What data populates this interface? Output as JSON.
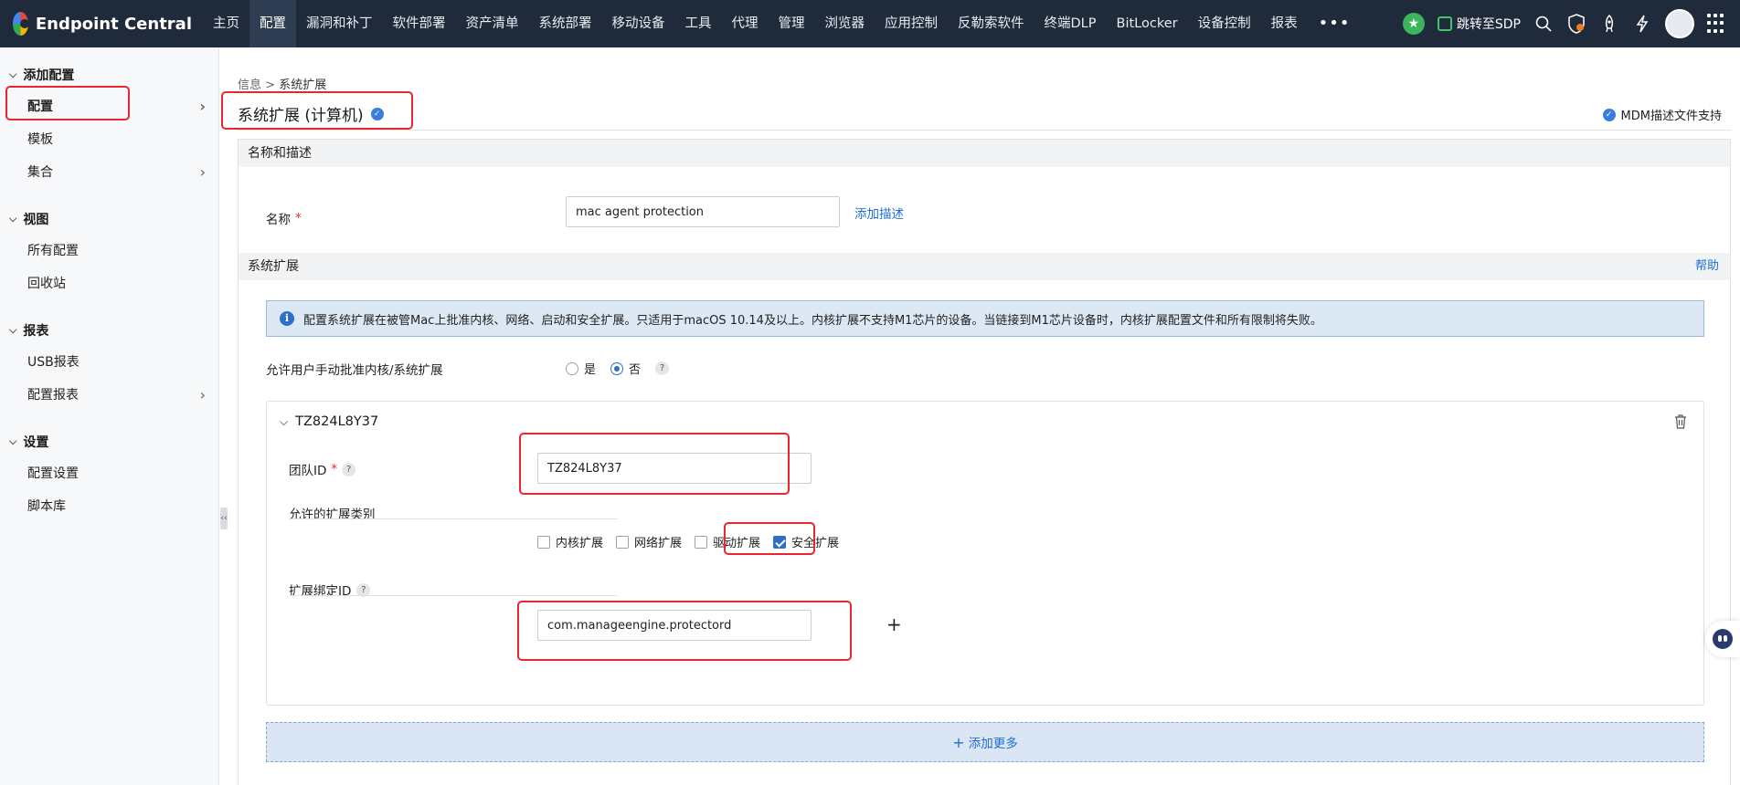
{
  "app": {
    "name": "Endpoint Central"
  },
  "nav": {
    "items": [
      "主页",
      "配置",
      "漏洞和补丁",
      "软件部署",
      "资产清单",
      "系统部署",
      "移动设备",
      "工具",
      "代理",
      "管理",
      "浏览器",
      "应用控制",
      "反勒索软件",
      "终端DLP",
      "BitLocker",
      "设备控制",
      "报表"
    ],
    "active": "配置",
    "more": "•••",
    "sdp_label": "跳转至SDP"
  },
  "sidebar": {
    "sections": [
      {
        "title": "添加配置",
        "items": [
          {
            "label": "配置",
            "has_children": true,
            "active": true
          },
          {
            "label": "模板",
            "has_children": false
          },
          {
            "label": "集合",
            "has_children": true
          }
        ]
      },
      {
        "title": "视图",
        "items": [
          {
            "label": "所有配置",
            "has_children": false
          },
          {
            "label": "回收站",
            "has_children": false
          }
        ]
      },
      {
        "title": "报表",
        "items": [
          {
            "label": "USB报表",
            "has_children": false
          },
          {
            "label": "配置报表",
            "has_children": true
          }
        ]
      },
      {
        "title": "设置",
        "items": [
          {
            "label": "配置设置",
            "has_children": false
          },
          {
            "label": "脚本库",
            "has_children": false
          }
        ]
      }
    ]
  },
  "breadcrumb": {
    "parent": "信息",
    "separator": ">",
    "current": "系统扩展"
  },
  "page": {
    "title": "系统扩展 (计算机)",
    "mdm_label": "MDM描述文件支持"
  },
  "name_section": {
    "header": "名称和描述",
    "name_label": "名称",
    "name_value": "mac agent protection",
    "add_description": "添加描述"
  },
  "ext_section": {
    "header": "系统扩展",
    "help": "帮助",
    "info": "配置系统扩展在被管Mac上批准内核、网络、启动和安全扩展。只适用于macOS 10.14及以上。内核扩展不支持M1芯片的设备。当链接到M1芯片设备时，内核扩展配置文件和所有限制将失败。",
    "allow_label": "允许用户手动批准内核/系统扩展",
    "allow_options": [
      {
        "label": "是",
        "selected": false
      },
      {
        "label": "否",
        "selected": true
      }
    ]
  },
  "team": {
    "title": "TZ824L8Y37",
    "team_id_label": "团队ID",
    "team_id_value": "TZ824L8Y37",
    "types_label": "允许的扩展类别",
    "types": [
      {
        "label": "内核扩展",
        "checked": false
      },
      {
        "label": "网络扩展",
        "checked": false
      },
      {
        "label": "驱动扩展",
        "checked": false
      },
      {
        "label": "安全扩展",
        "checked": true
      }
    ],
    "bundle_label": "扩展绑定ID",
    "bundle_value": "com.manageengine.protectord"
  },
  "add_more": "添加更多",
  "colors": {
    "topbar": "#1f2a3a",
    "accent": "#2f6fc9",
    "highlight": "#e8262e",
    "link": "#1f6fd0"
  }
}
